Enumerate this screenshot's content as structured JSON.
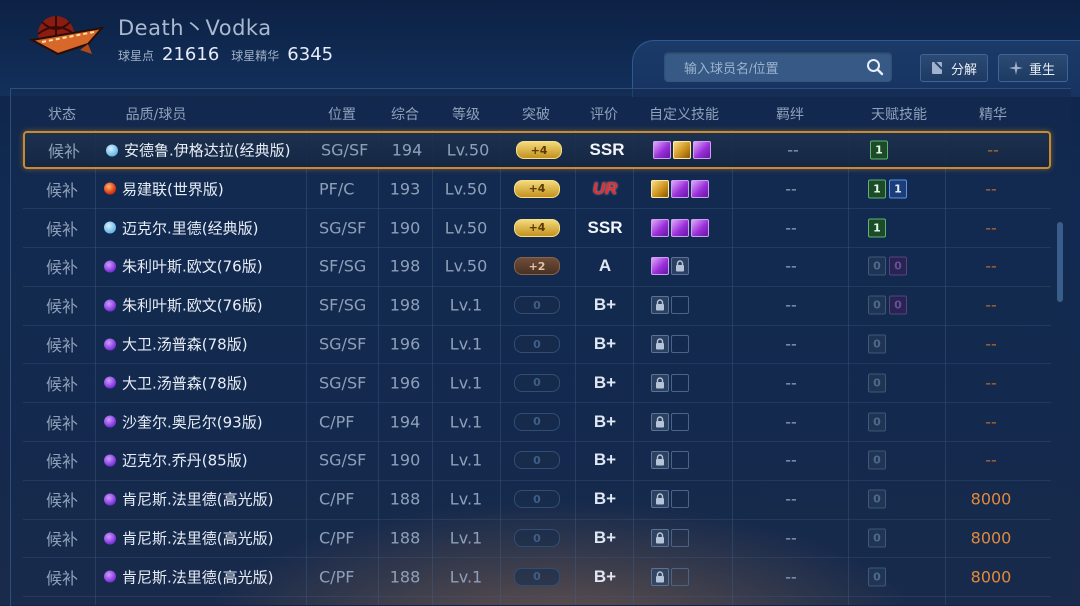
{
  "header": {
    "team_name": "Death丶Vodka",
    "points_label": "球星点",
    "points_value": "21616",
    "essence_label": "球星精华",
    "essence_value": "6345"
  },
  "search": {
    "placeholder": "输入球员名/位置"
  },
  "buttons": {
    "decompose": "分解",
    "rebirth": "重生"
  },
  "columns": [
    "状态",
    "品质/球员",
    "位置",
    "综合",
    "等级",
    "突破",
    "评价",
    "自定义技能",
    "羁绊",
    "天赋技能",
    "精华"
  ],
  "rows": [
    {
      "status": "候补",
      "quality": "blue",
      "name": "安德鲁.伊格达拉(经典版)",
      "pos": "SG/SF",
      "ovr": "194",
      "level": "Lv.50",
      "breakthrough": "+4",
      "bt_style": "gold",
      "rating": "SSR",
      "rating_style": "ssr",
      "skills": [
        "purple",
        "gold",
        "purple"
      ],
      "bond": "--",
      "talents": [
        {
          "v": "1",
          "s": "green"
        }
      ],
      "essence": "--",
      "selected": true
    },
    {
      "status": "候补",
      "quality": "red",
      "name": "易建联(世界版)",
      "pos": "PF/C",
      "ovr": "193",
      "level": "Lv.50",
      "breakthrough": "+4",
      "bt_style": "gold",
      "rating": "UR",
      "rating_style": "ur",
      "skills": [
        "gold",
        "purple",
        "purple"
      ],
      "bond": "--",
      "talents": [
        {
          "v": "1",
          "s": "green"
        },
        {
          "v": "1",
          "s": "blue"
        }
      ],
      "essence": "--",
      "selected": false
    },
    {
      "status": "候补",
      "quality": "blue",
      "name": "迈克尔.里德(经典版)",
      "pos": "SG/SF",
      "ovr": "190",
      "level": "Lv.50",
      "breakthrough": "+4",
      "bt_style": "gold",
      "rating": "SSR",
      "rating_style": "ssr",
      "skills": [
        "purple",
        "purple",
        "purple"
      ],
      "bond": "--",
      "talents": [
        {
          "v": "1",
          "s": "green"
        }
      ],
      "essence": "--",
      "selected": false
    },
    {
      "status": "候补",
      "quality": "purple",
      "name": "朱利叶斯.欧文(76版)",
      "pos": "SF/SG",
      "ovr": "198",
      "level": "Lv.50",
      "breakthrough": "+2",
      "bt_style": "bronze",
      "rating": "A",
      "rating_style": "a",
      "skills": [
        "purple",
        "lock"
      ],
      "bond": "--",
      "talents": [
        {
          "v": "0",
          "s": "dim"
        },
        {
          "v": "0",
          "s": "dimp"
        }
      ],
      "essence": "--",
      "selected": false
    },
    {
      "status": "候补",
      "quality": "purple",
      "name": "朱利叶斯.欧文(76版)",
      "pos": "SF/SG",
      "ovr": "198",
      "level": "Lv.1",
      "breakthrough": "0",
      "bt_style": "empty",
      "rating": "B+",
      "rating_style": "b",
      "skills": [
        "lock",
        "empty"
      ],
      "bond": "--",
      "talents": [
        {
          "v": "0",
          "s": "dim"
        },
        {
          "v": "0",
          "s": "dimp"
        }
      ],
      "essence": "--",
      "selected": false
    },
    {
      "status": "候补",
      "quality": "purple",
      "name": "大卫.汤普森(78版)",
      "pos": "SG/SF",
      "ovr": "196",
      "level": "Lv.1",
      "breakthrough": "0",
      "bt_style": "empty",
      "rating": "B+",
      "rating_style": "b",
      "skills": [
        "lock",
        "empty"
      ],
      "bond": "--",
      "talents": [
        {
          "v": "0",
          "s": "dim"
        }
      ],
      "essence": "--",
      "selected": false
    },
    {
      "status": "候补",
      "quality": "purple",
      "name": "大卫.汤普森(78版)",
      "pos": "SG/SF",
      "ovr": "196",
      "level": "Lv.1",
      "breakthrough": "0",
      "bt_style": "empty",
      "rating": "B+",
      "rating_style": "b",
      "skills": [
        "lock",
        "empty"
      ],
      "bond": "--",
      "talents": [
        {
          "v": "0",
          "s": "dim"
        }
      ],
      "essence": "--",
      "selected": false
    },
    {
      "status": "候补",
      "quality": "purple",
      "name": "沙奎尔.奥尼尔(93版)",
      "pos": "C/PF",
      "ovr": "194",
      "level": "Lv.1",
      "breakthrough": "0",
      "bt_style": "empty",
      "rating": "B+",
      "rating_style": "b",
      "skills": [
        "lock",
        "empty"
      ],
      "bond": "--",
      "talents": [
        {
          "v": "0",
          "s": "dim"
        }
      ],
      "essence": "--",
      "selected": false
    },
    {
      "status": "候补",
      "quality": "purple",
      "name": "迈克尔.乔丹(85版)",
      "pos": "SG/SF",
      "ovr": "190",
      "level": "Lv.1",
      "breakthrough": "0",
      "bt_style": "empty",
      "rating": "B+",
      "rating_style": "b",
      "skills": [
        "lock",
        "empty"
      ],
      "bond": "--",
      "talents": [
        {
          "v": "0",
          "s": "dim"
        }
      ],
      "essence": "--",
      "selected": false
    },
    {
      "status": "候补",
      "quality": "purple",
      "name": "肯尼斯.法里德(高光版)",
      "pos": "C/PF",
      "ovr": "188",
      "level": "Lv.1",
      "breakthrough": "0",
      "bt_style": "empty",
      "rating": "B+",
      "rating_style": "b",
      "skills": [
        "lock",
        "empty"
      ],
      "bond": "--",
      "talents": [
        {
          "v": "0",
          "s": "dim"
        }
      ],
      "essence": "8000",
      "selected": false
    },
    {
      "status": "候补",
      "quality": "purple",
      "name": "肯尼斯.法里德(高光版)",
      "pos": "C/PF",
      "ovr": "188",
      "level": "Lv.1",
      "breakthrough": "0",
      "bt_style": "empty",
      "rating": "B+",
      "rating_style": "b",
      "skills": [
        "lock",
        "empty"
      ],
      "bond": "--",
      "talents": [
        {
          "v": "0",
          "s": "dim"
        }
      ],
      "essence": "8000",
      "selected": false
    },
    {
      "status": "候补",
      "quality": "purple",
      "name": "肯尼斯.法里德(高光版)",
      "pos": "C/PF",
      "ovr": "188",
      "level": "Lv.1",
      "breakthrough": "0",
      "bt_style": "empty",
      "rating": "B+",
      "rating_style": "b",
      "skills": [
        "lock",
        "empty"
      ],
      "bond": "--",
      "talents": [
        {
          "v": "0",
          "s": "dim"
        }
      ],
      "essence": "8000",
      "selected": false
    }
  ],
  "colors": {
    "accent_gold": "#c98a2e",
    "essence_orange": "#e08a3a",
    "ur_red": "#e23030"
  },
  "icons": [
    "team-logo-icon",
    "search-icon",
    "decompose-icon",
    "rebirth-icon",
    "lock-icon"
  ]
}
